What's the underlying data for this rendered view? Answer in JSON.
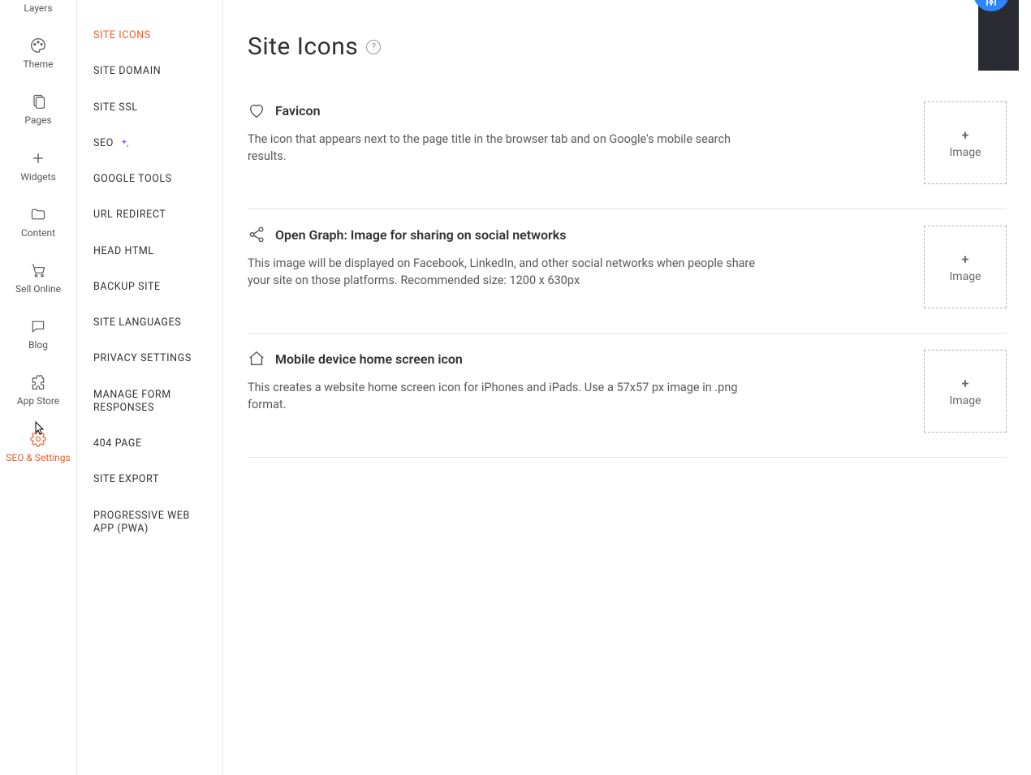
{
  "rail": {
    "items": [
      {
        "label": "Layers",
        "icon": "layers"
      },
      {
        "label": "Theme",
        "icon": "palette"
      },
      {
        "label": "Pages",
        "icon": "pages"
      },
      {
        "label": "Widgets",
        "icon": "plus"
      },
      {
        "label": "Content",
        "icon": "folder"
      },
      {
        "label": "Sell Online",
        "icon": "cart"
      },
      {
        "label": "Blog",
        "icon": "chat"
      },
      {
        "label": "App Store",
        "icon": "puzzle"
      },
      {
        "label": "SEO & Settings",
        "icon": "gear",
        "active": true
      }
    ]
  },
  "sidebar": {
    "items": [
      {
        "label": "SITE ICONS",
        "active": true
      },
      {
        "label": "SITE DOMAIN"
      },
      {
        "label": "SITE SSL"
      },
      {
        "label": "SEO",
        "sparkle": true
      },
      {
        "label": "GOOGLE TOOLS"
      },
      {
        "label": "URL REDIRECT"
      },
      {
        "label": "HEAD HTML"
      },
      {
        "label": "BACKUP SITE"
      },
      {
        "label": "SITE LANGUAGES"
      },
      {
        "label": "PRIVACY SETTINGS"
      },
      {
        "label": "MANAGE FORM RESPONSES"
      },
      {
        "label": "404 PAGE"
      },
      {
        "label": "SITE EXPORT"
      },
      {
        "label": "PROGRESSIVE WEB APP (PWA)"
      }
    ]
  },
  "main": {
    "title": "Site Icons",
    "help_tooltip": "?",
    "sections": [
      {
        "icon": "heart",
        "heading": "Favicon",
        "desc": "The icon that appears next to the page title in the browser tab and on Google's mobile search results.",
        "drop_label": "Image"
      },
      {
        "icon": "share",
        "heading": "Open Graph: Image for sharing on social networks",
        "desc": "This image will be displayed on Facebook, LinkedIn, and other social networks when people share your site on those platforms. Recommended size: 1200 x 630px",
        "drop_label": "Image"
      },
      {
        "icon": "home",
        "heading": "Mobile device home screen icon",
        "desc": "This creates a website home screen icon for iPhones and iPads. Use a 57x57 px image in .png format.",
        "drop_label": "Image"
      }
    ]
  }
}
